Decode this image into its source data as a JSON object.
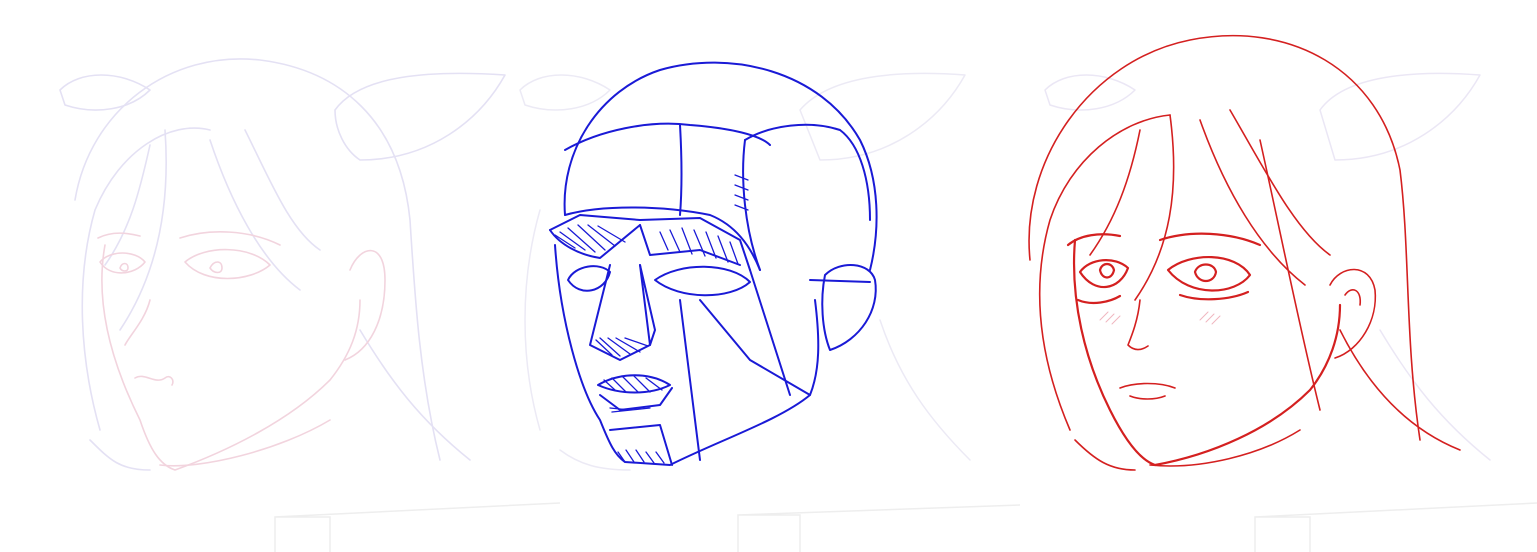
{
  "scene": {
    "panels": [
      {
        "name": "panel-1-faded-sketch",
        "ghost_color": "#e6e3f5",
        "ink_color": "#f2d3dc"
      },
      {
        "name": "panel-2-planar-head",
        "ghost_color": "#eceaf5",
        "ink_color": "#1a1ad6"
      },
      {
        "name": "panel-3-line-art",
        "ghost_color": "#ece8f5",
        "ink_color": "#d42020"
      }
    ],
    "box_guide_color": "#eeeeee",
    "background": "#ffffff"
  }
}
